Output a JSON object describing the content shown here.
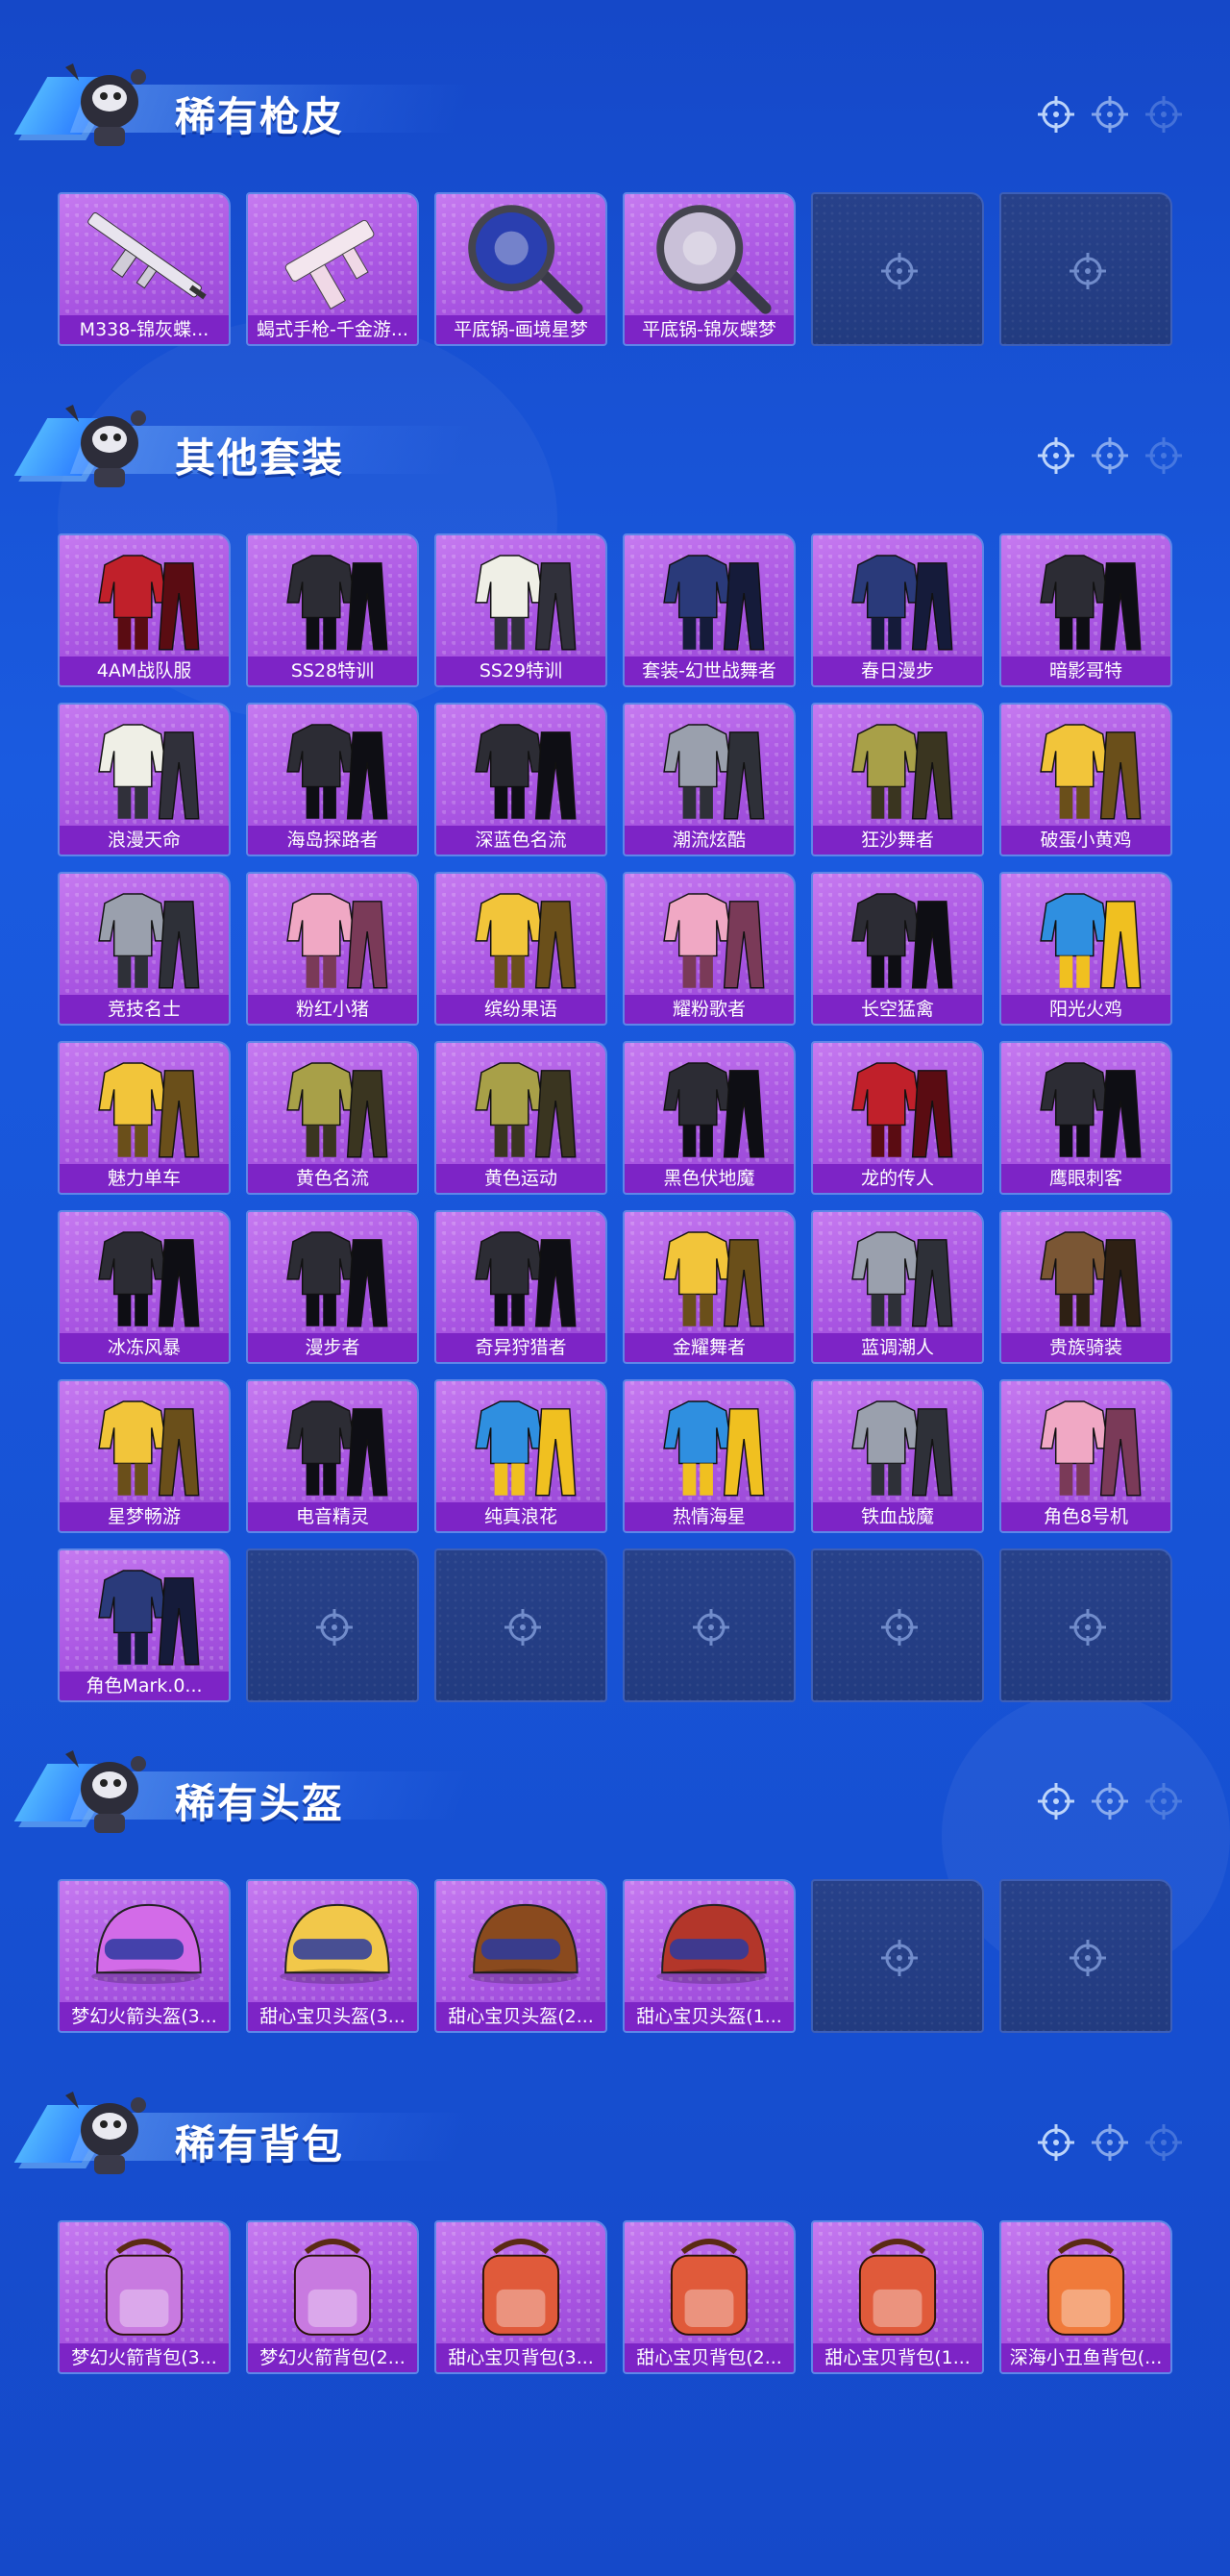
{
  "icons": {
    "empty_slot": "crosshair-icon",
    "header_deco": "crosshair-icon",
    "mascot": "mascot-icon"
  },
  "sections": [
    {
      "id": "rare-gun-skins",
      "title": "稀有枪皮",
      "items": [
        {
          "label": "M338-锦灰蝶...",
          "art": "rifle"
        },
        {
          "label": "蝎式手枪-千金游...",
          "art": "pistol"
        },
        {
          "label": "平底锅-画境星梦",
          "art": "pan-blue"
        },
        {
          "label": "平底锅-锦灰蝶梦",
          "art": "pan-grey"
        }
      ],
      "empty_slots": 2
    },
    {
      "id": "other-outfits",
      "title": "其他套装",
      "items": [
        {
          "label": "4AM战队服",
          "art": "outfit-red"
        },
        {
          "label": "SS28特训",
          "art": "outfit-dark"
        },
        {
          "label": "SS29特训",
          "art": "outfit-white"
        },
        {
          "label": "套装-幻世战舞者",
          "art": "outfit-navy"
        },
        {
          "label": "春日漫步",
          "art": "outfit-navy"
        },
        {
          "label": "暗影哥特",
          "art": "outfit-dark"
        },
        {
          "label": "浪漫天命",
          "art": "outfit-white"
        },
        {
          "label": "海岛探路者",
          "art": "outfit-dark"
        },
        {
          "label": "深蓝色名流",
          "art": "outfit-dark"
        },
        {
          "label": "潮流炫酷",
          "art": "outfit-grey"
        },
        {
          "label": "狂沙舞者",
          "art": "outfit-olive"
        },
        {
          "label": "破蛋小黄鸡",
          "art": "outfit-yellow"
        },
        {
          "label": "竞技名士",
          "art": "outfit-grey"
        },
        {
          "label": "粉红小猪",
          "art": "outfit-pink"
        },
        {
          "label": "缤纷果语",
          "art": "outfit-yellow"
        },
        {
          "label": "耀粉歌者",
          "art": "outfit-pink"
        },
        {
          "label": "长空猛禽",
          "art": "outfit-dark"
        },
        {
          "label": "阳光火鸡",
          "art": "outfit-blue"
        },
        {
          "label": "魅力单车",
          "art": "outfit-yellow"
        },
        {
          "label": "黄色名流",
          "art": "outfit-olive"
        },
        {
          "label": "黄色运动",
          "art": "outfit-olive"
        },
        {
          "label": "黑色伏地魔",
          "art": "outfit-dark"
        },
        {
          "label": "龙的传人",
          "art": "outfit-red"
        },
        {
          "label": "鹰眼刺客",
          "art": "outfit-dark"
        },
        {
          "label": "冰冻风暴",
          "art": "outfit-dark"
        },
        {
          "label": "漫步者",
          "art": "outfit-dark"
        },
        {
          "label": "奇异狩猎者",
          "art": "outfit-dark"
        },
        {
          "label": "金耀舞者",
          "art": "outfit-yellow"
        },
        {
          "label": "蓝调潮人",
          "art": "outfit-grey"
        },
        {
          "label": "贵族骑装",
          "art": "outfit-brown"
        },
        {
          "label": "星梦畅游",
          "art": "outfit-yellow"
        },
        {
          "label": "电音精灵",
          "art": "outfit-dark"
        },
        {
          "label": "纯真浪花",
          "art": "outfit-blue"
        },
        {
          "label": "热情海星",
          "art": "outfit-blue"
        },
        {
          "label": "铁血战魔",
          "art": "outfit-grey"
        },
        {
          "label": "角色8号机",
          "art": "outfit-pink"
        },
        {
          "label": "角色Mark.0...",
          "art": "outfit-navy"
        }
      ],
      "empty_slots": 5
    },
    {
      "id": "rare-helmets",
      "title": "稀有头盔",
      "items": [
        {
          "label": "梦幻火箭头盔(3...",
          "art": "helmet-pink"
        },
        {
          "label": "甜心宝贝头盔(3...",
          "art": "helmet-yellow"
        },
        {
          "label": "甜心宝贝头盔(2...",
          "art": "helmet-brown"
        },
        {
          "label": "甜心宝贝头盔(1...",
          "art": "helmet-red"
        }
      ],
      "empty_slots": 2
    },
    {
      "id": "rare-backpacks",
      "title": "稀有背包",
      "items": [
        {
          "label": "梦幻火箭背包(3...",
          "art": "pack-pink"
        },
        {
          "label": "梦幻火箭背包(2...",
          "art": "pack-pink"
        },
        {
          "label": "甜心宝贝背包(3...",
          "art": "pack-sweet"
        },
        {
          "label": "甜心宝贝背包(2...",
          "art": "pack-sweet"
        },
        {
          "label": "甜心宝贝背包(1...",
          "art": "pack-sweet"
        },
        {
          "label": "深海小丑鱼背包(...",
          "art": "pack-fish"
        }
      ],
      "empty_slots": 0
    }
  ]
}
